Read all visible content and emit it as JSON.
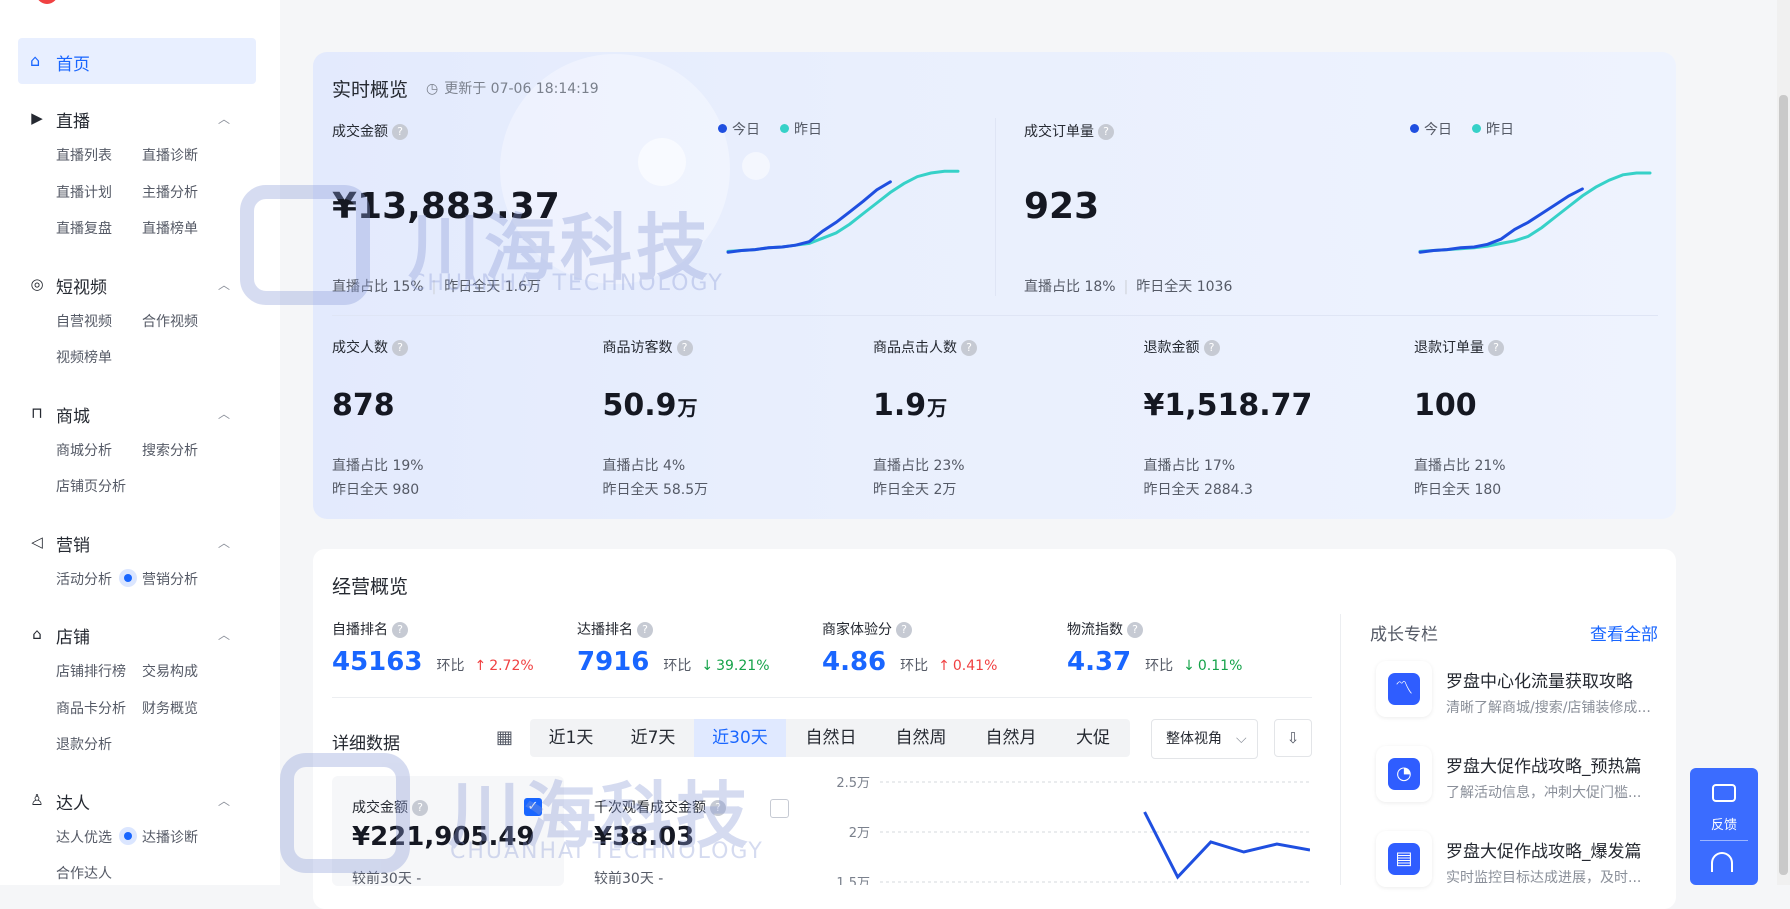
{
  "sidebar": {
    "home": "首页",
    "sections": [
      {
        "title": "直播",
        "items": [
          [
            "直播列表",
            "直播诊断"
          ],
          [
            "直播计划",
            "主播分析"
          ],
          [
            "直播复盘",
            "直播榜单"
          ]
        ]
      },
      {
        "title": "短视频",
        "items": [
          [
            "自营视频",
            "合作视频"
          ],
          [
            "视频榜单",
            ""
          ]
        ]
      },
      {
        "title": "商城",
        "items": [
          [
            "商城分析",
            "搜索分析"
          ],
          [
            "店铺页分析",
            ""
          ]
        ]
      },
      {
        "title": "营销",
        "items": [
          [
            "活动分析",
            "营销分析"
          ]
        ]
      },
      {
        "title": "店铺",
        "items": [
          [
            "店铺排行榜",
            "交易构成"
          ],
          [
            "商品卡分析",
            "财务概览"
          ],
          [
            "退款分析",
            ""
          ]
        ]
      },
      {
        "title": "达人",
        "items": [
          [
            "达人优选",
            "达播诊断"
          ],
          [
            "合作达人",
            ""
          ]
        ]
      }
    ]
  },
  "realtime": {
    "title": "实时概览",
    "updated": "更新于 07-06 18:14:19",
    "legend_today": "今日",
    "legend_yesterday": "昨日",
    "gmv": {
      "label": "成交金额",
      "value": "¥13,883.37",
      "live_share": "直播占比 15%",
      "yesterday": "昨日全天 1.6万"
    },
    "orders": {
      "label": "成交订单量",
      "value": "923",
      "live_share": "直播占比 18%",
      "yesterday": "昨日全天 1036"
    },
    "metrics": [
      {
        "label": "成交人数",
        "value": "878",
        "unit": "",
        "live_share": "直播占比 19%",
        "yesterday": "昨日全天 980"
      },
      {
        "label": "商品访客数",
        "value": "50.9",
        "unit": "万",
        "live_share": "直播占比 4%",
        "yesterday": "昨日全天 58.5万"
      },
      {
        "label": "商品点击人数",
        "value": "1.9",
        "unit": "万",
        "live_share": "直播占比 23%",
        "yesterday": "昨日全天 2万"
      },
      {
        "label": "退款金额",
        "value": "¥1,518.77",
        "unit": "",
        "live_share": "直播占比 17%",
        "yesterday": "昨日全天 2884.3"
      },
      {
        "label": "退款订单量",
        "value": "100",
        "unit": "",
        "live_share": "直播占比 21%",
        "yesterday": "昨日全天 180"
      }
    ],
    "colors": {
      "today": "#1f4fe0",
      "yesterday": "#36d1c8"
    }
  },
  "business": {
    "title": "经营概览",
    "ring_label": "环比",
    "kpis": [
      {
        "label": "自播排名",
        "value": "45163",
        "change": "2.72%",
        "dir": "up"
      },
      {
        "label": "达播排名",
        "value": "7916",
        "change": "39.21%",
        "dir": "down"
      },
      {
        "label": "商家体验分",
        "value": "4.86",
        "change": "0.41%",
        "dir": "up"
      },
      {
        "label": "物流指数",
        "value": "4.37",
        "change": "0.11%",
        "dir": "down"
      }
    ],
    "detail_title": "详细数据",
    "tabs": [
      "近1天",
      "近7天",
      "近30天",
      "自然日",
      "自然周",
      "自然月",
      "大促"
    ],
    "active_tab": 2,
    "view_select": "整体视角",
    "cards": [
      {
        "label": "成交金额",
        "value": "¥221,905.49",
        "compare": "较前30天 -"
      },
      {
        "label": "千次观看成交金额",
        "value": "¥38.03",
        "compare": "较前30天 -"
      }
    ],
    "chart_y_ticks": [
      "2.5万",
      "2万",
      "1.5万"
    ]
  },
  "growth": {
    "title": "成长专栏",
    "view_all": "查看全部",
    "items": [
      {
        "title": "罗盘中心化流量获取攻略",
        "desc": "清晰了解商城/搜索/店铺装修成..."
      },
      {
        "title": "罗盘大促作战攻略_预热篇",
        "desc": "了解活动信息，冲刺大促门槛..."
      },
      {
        "title": "罗盘大促作战攻略_爆发篇",
        "desc": "实时监控目标达成进展，及时..."
      }
    ]
  },
  "feedback": {
    "label": "反馈"
  },
  "watermark": {
    "cn": "川海科技",
    "en": "CHUANHAI TECHNOLOGY"
  },
  "chart_data": [
    {
      "type": "line",
      "x": [
        0,
        1,
        2,
        3,
        4,
        5,
        6,
        7,
        8,
        9,
        10,
        11,
        12,
        13,
        14,
        15,
        16,
        17
      ],
      "series": [
        {
          "name": "今日",
          "values": [
            2,
            4,
            5,
            7,
            8,
            10,
            14,
            26,
            36,
            48,
            60,
            73,
            82,
            null,
            null,
            null,
            null,
            null
          ]
        },
        {
          "name": "昨日",
          "values": [
            3,
            4,
            5,
            7,
            8,
            10,
            12,
            18,
            24,
            34,
            46,
            58,
            70,
            80,
            88,
            92,
            94,
            94
          ]
        }
      ]
    },
    {
      "type": "line",
      "x": [
        0,
        1,
        2,
        3,
        4,
        5,
        6,
        7,
        8,
        9,
        10,
        11,
        12,
        13,
        14,
        15,
        16,
        17
      ],
      "series": [
        {
          "name": "今日",
          "values": [
            2,
            4,
            5,
            7,
            8,
            11,
            17,
            28,
            36,
            46,
            56,
            66,
            74,
            null,
            null,
            null,
            null,
            null
          ]
        },
        {
          "name": "昨日",
          "values": [
            3,
            4,
            5,
            6,
            7,
            9,
            12,
            15,
            20,
            30,
            42,
            54,
            66,
            76,
            84,
            90,
            92,
            92
          ]
        }
      ]
    },
    {
      "type": "line",
      "yticks": [
        "2.5万",
        "2万",
        "1.5万"
      ],
      "ylim": [
        15000,
        25000
      ],
      "x": [
        0,
        1,
        2,
        3,
        4,
        5,
        6,
        7,
        8,
        9,
        10,
        11,
        12,
        13
      ],
      "series": [
        {
          "name": "",
          "values": [
            null,
            null,
            null,
            null,
            null,
            null,
            null,
            null,
            22000,
            15500,
            19000,
            18000,
            18800,
            18200
          ]
        }
      ]
    }
  ]
}
